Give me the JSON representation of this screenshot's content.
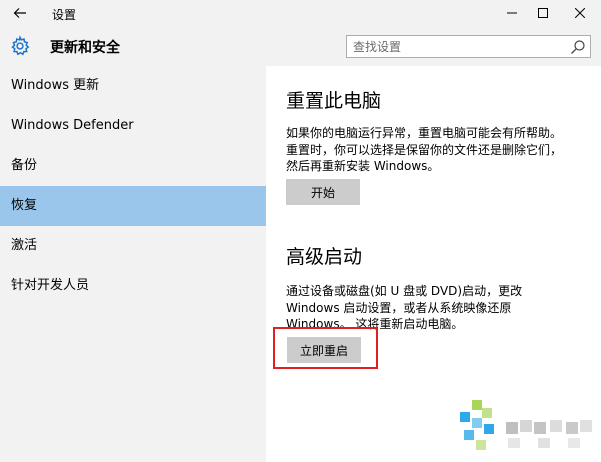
{
  "window": {
    "title": "设置"
  },
  "sidebar": {
    "title": "更新和安全",
    "items": [
      {
        "label": "Windows 更新",
        "active": false
      },
      {
        "label": "Windows Defender",
        "active": false
      },
      {
        "label": "备份",
        "active": false
      },
      {
        "label": "恢复",
        "active": true
      },
      {
        "label": "激活",
        "active": false
      },
      {
        "label": "针对开发人员",
        "active": false
      }
    ]
  },
  "search": {
    "placeholder": "查找设置"
  },
  "reset": {
    "title": "重置此电脑",
    "line1": "如果你的电脑运行异常，重置电脑可能会有所帮助。",
    "line2": "重置时，你可以选择是保留你的文件还是删除它们，",
    "line3": "然后再重新安装 Windows。",
    "button": "开始"
  },
  "advanced": {
    "title": "高级启动",
    "line1": "通过设备或磁盘(如 U 盘或 DVD)启动，更改",
    "line2": "Windows 启动设置，或者从系统映像还原",
    "line3": "Windows。 这将重新启动电脑。",
    "button": "立即重启"
  },
  "colors": {
    "accent": "#99c6ea",
    "highlight": "#e02020",
    "button_bg": "#cccccc",
    "sidebar_bg": "#f2f2f2"
  },
  "icons": [
    "back-arrow-icon",
    "gear-icon",
    "search-icon",
    "minimize-icon",
    "maximize-icon",
    "close-icon"
  ]
}
